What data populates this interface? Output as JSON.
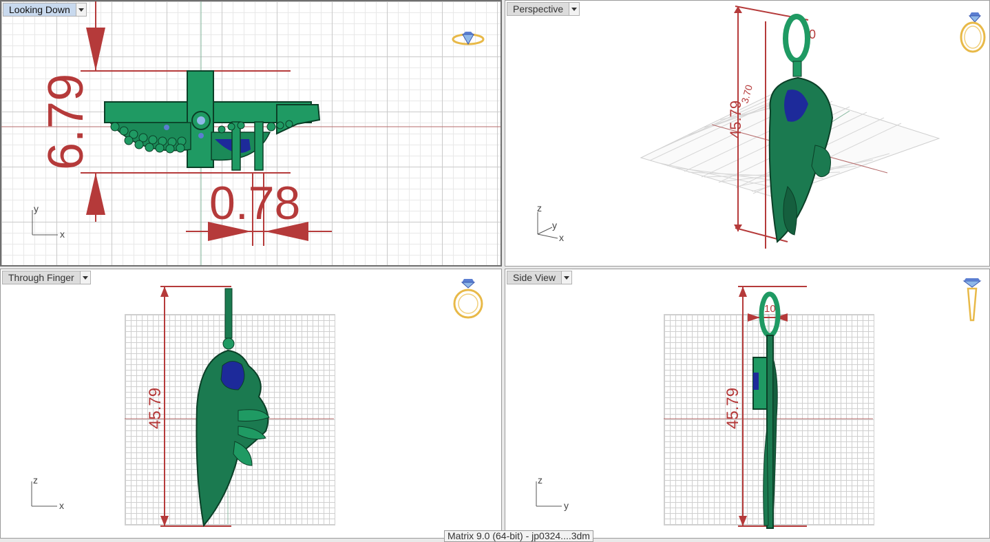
{
  "viewports": {
    "top_left": {
      "title": "Looking Down",
      "axis_v": "y",
      "axis_h": "x",
      "dim_height": "6.79",
      "dim_gap": "0.78"
    },
    "top_right": {
      "title": "Perspective",
      "axis_v": "z",
      "axis_d": "y",
      "axis_h": "x",
      "dim_length": "45.79",
      "dim_small_a": "3.70",
      "dim_small_b": "0"
    },
    "bottom_left": {
      "title": "Through Finger",
      "axis_v": "z",
      "axis_h": "x",
      "dim_length": "45.79"
    },
    "bottom_right": {
      "title": "Side View",
      "axis_v": "z",
      "axis_h": "y",
      "dim_length": "45.79",
      "dim_small": "10"
    }
  },
  "status": {
    "text": "Matrix 9.0 (64-bit) - jp0324....3dm"
  },
  "colors": {
    "model_green": "#1f9a63",
    "dimension_red": "#b53a3a",
    "gem_blue": "#1d2a9a",
    "icon_gold": "#e8b948"
  }
}
